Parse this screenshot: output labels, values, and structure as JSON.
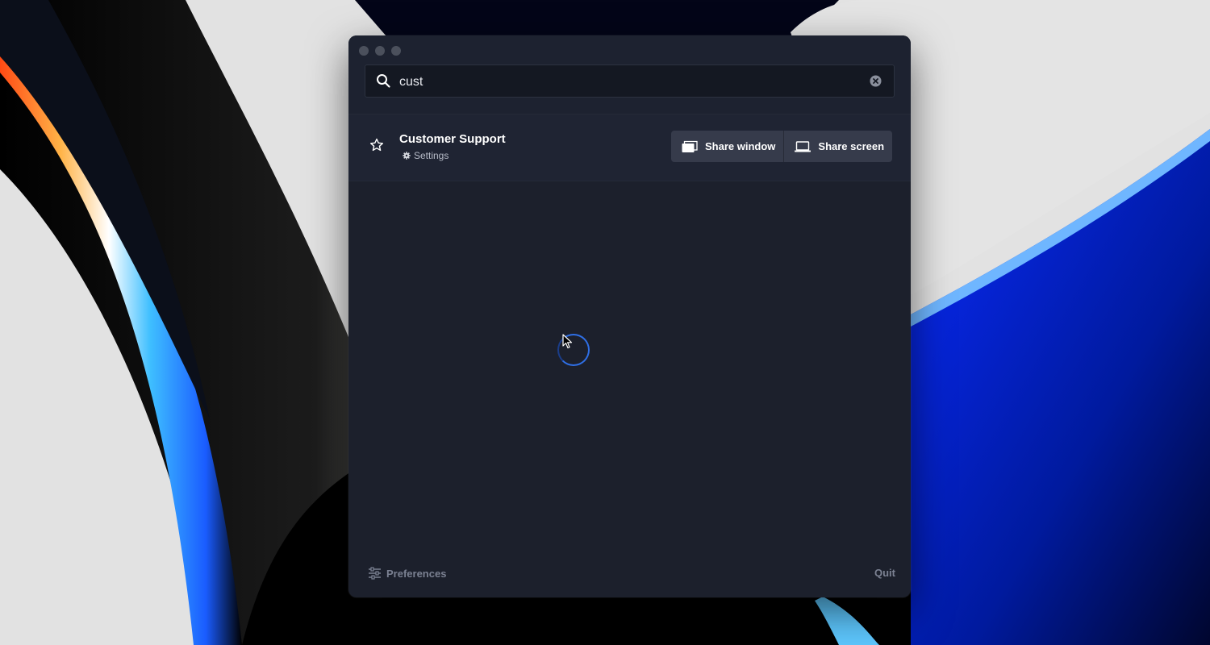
{
  "search": {
    "value": "cust",
    "icon": "search-icon",
    "clear_icon": "clear-icon"
  },
  "result": {
    "title": "Customer Support",
    "subtitle": "Settings",
    "star_icon": "star-icon",
    "subtitle_icon": "gear-icon",
    "share_window_label": "Share window",
    "share_screen_label": "Share screen"
  },
  "footer": {
    "preferences_label": "Preferences",
    "quit_label": "Quit"
  },
  "colors": {
    "window_bg": "#1c202c",
    "button_bg": "#363b4b",
    "spinner_accent": "#2f6fe6"
  }
}
